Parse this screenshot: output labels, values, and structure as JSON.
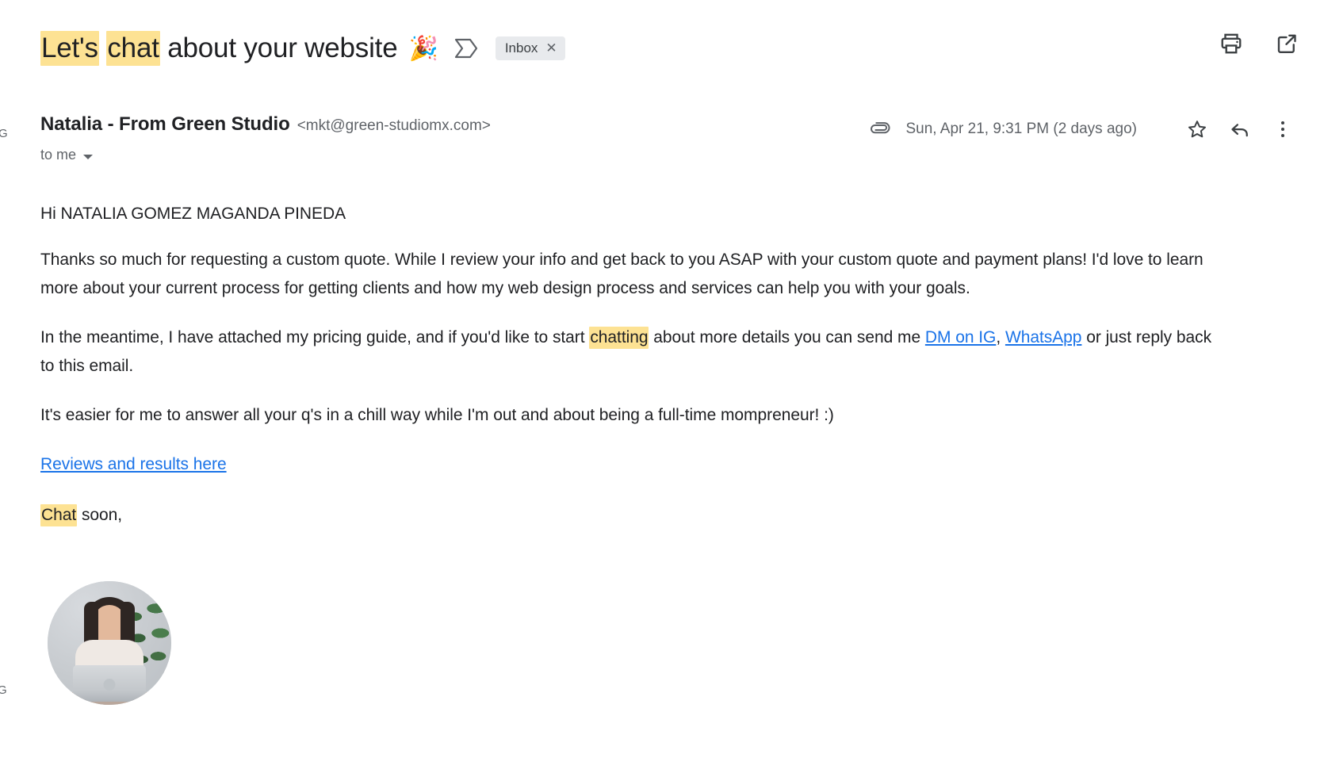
{
  "edge": {
    "left_glyph_top": "G",
    "left_glyph_bottom": "G"
  },
  "subject": {
    "highlight_1": "Let's",
    "highlight_2": "chat",
    "rest": "about your website",
    "emoji": "🎉",
    "emoji_name": "party-popper",
    "label_icon": "label-icon",
    "chip_label": "Inbox",
    "chip_close": "✕"
  },
  "toolbar": {
    "print_label": "print-icon",
    "popout_label": "open-in-new-window-icon"
  },
  "sender": {
    "name": "Natalia - From Green Studio",
    "email": "<mkt@green-studiomx.com>",
    "recipient": "to me",
    "caret_icon": "chevron-down-icon"
  },
  "meta": {
    "attachment_icon": "paperclip-icon",
    "date": "Sun, Apr 21, 9:31 PM (2 days ago)",
    "star_icon": "star-icon",
    "reply_icon": "reply-icon",
    "more_icon": "more-options-icon"
  },
  "body": {
    "greeting": "Hi NATALIA GOMEZ MAGANDA PINEDA",
    "paragraph_1": "Thanks so much for requesting a custom quote. While I review your info and get back to you ASAP with your custom quote and payment plans! I'd love to learn more about your current process for getting clients and how my web design process and services can help you with your goals.",
    "paragraph_2_part_1": "In the meantime, I have attached my pricing guide, and if you'd like to start ",
    "paragraph_2_highlight": "chatting",
    "paragraph_2_part_2": " about more details you can send me ",
    "link_dm": "DM on IG",
    "paragraph_2_comma": ", ",
    "link_whatsapp": "WhatsApp",
    "paragraph_2_part_3": " or just reply back to this email.",
    "paragraph_3": "It's easier for me to answer all your q's in a chill way while I'm out and about being a full-time mompreneur! :)",
    "link_reviews": "Reviews and results here",
    "signoff_highlight": "Chat",
    "signoff_rest": " soon,"
  },
  "signature": {
    "avatar_name": "sender-profile-photo"
  },
  "colors": {
    "highlight": "#fde293",
    "link": "#1a73e8",
    "text": "#202124",
    "muted": "#5f6368",
    "chip_bg": "#e8eaed"
  }
}
